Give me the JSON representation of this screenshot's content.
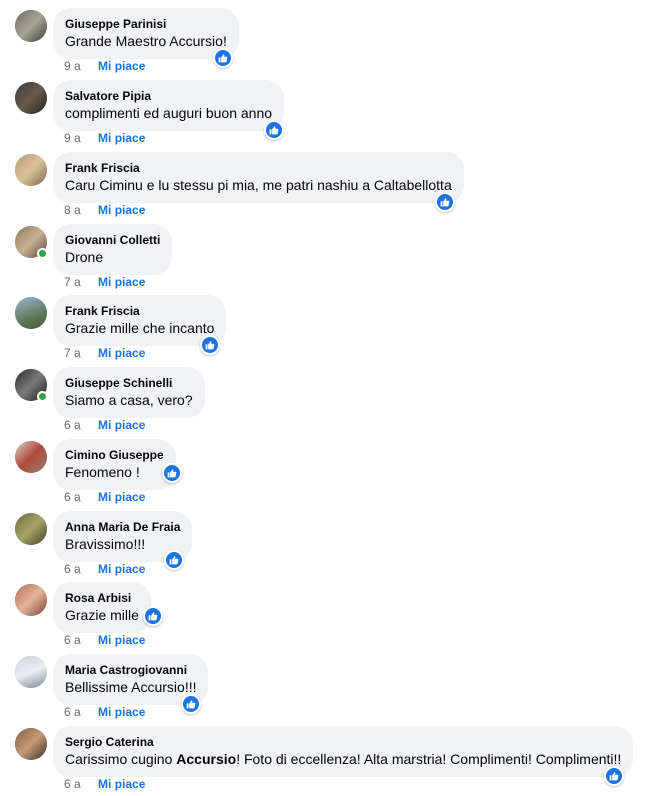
{
  "like_label": "Mi piace",
  "colors": {
    "bubble": "#f0f2f5",
    "accent": "#1b74e4",
    "online": "#31a24c",
    "meta": "#65676b"
  },
  "comments": [
    {
      "author": "Giuseppe Parinisi",
      "text": "Grande Maestro Accursio!",
      "age": "9 a",
      "liked": true,
      "online": false,
      "avatar": "avatar-photo"
    },
    {
      "author": "Salvatore Pipia",
      "text": "complimenti ed auguri buon anno",
      "age": "9 a",
      "liked": true,
      "online": false,
      "avatar": "avatar-photo"
    },
    {
      "author": "Frank Friscia",
      "text": "Caru Ciminu e lu stessu pi mia, me patri nashiu a Caltabellotta",
      "age": "8 a",
      "liked": true,
      "online": false,
      "avatar": "avatar-photo"
    },
    {
      "author": "Giovanni Colletti",
      "text": "Drone",
      "age": "7 a",
      "liked": false,
      "online": true,
      "avatar": "avatar-photo"
    },
    {
      "author": "Frank Friscia",
      "text": "Grazie mille che incanto",
      "age": "7 a",
      "liked": true,
      "online": false,
      "avatar": "avatar-photo"
    },
    {
      "author": "Giuseppe Schinelli",
      "text": "Siamo a casa, vero?",
      "age": "6 a",
      "liked": false,
      "online": true,
      "avatar": "avatar-photo"
    },
    {
      "author": "Cimino Giuseppe",
      "text": "Fenomeno !",
      "age": "6 a",
      "liked": true,
      "online": false,
      "avatar": "avatar-photo"
    },
    {
      "author": "Anna Maria De Fraia",
      "text": "Bravissimo!!!",
      "age": "6 a",
      "liked": true,
      "online": false,
      "avatar": "avatar-photo"
    },
    {
      "author": "Rosa Arbisi",
      "text": "Grazie mille",
      "age": "6 a",
      "liked": true,
      "online": false,
      "avatar": "avatar-photo"
    },
    {
      "author": "Maria Castrogiovanni",
      "text": "Bellissime Accursio!!!",
      "age": "6 a",
      "liked": true,
      "online": false,
      "avatar": "avatar-photo"
    },
    {
      "author": "Sergio Caterina",
      "text_parts": [
        "Carissimo cugino ",
        "Accursio",
        "! Foto di eccellenza! Alta marstria! Complimenti! Complimenti!!"
      ],
      "age": "6 a",
      "liked": true,
      "online": false,
      "avatar": "avatar-photo"
    }
  ]
}
